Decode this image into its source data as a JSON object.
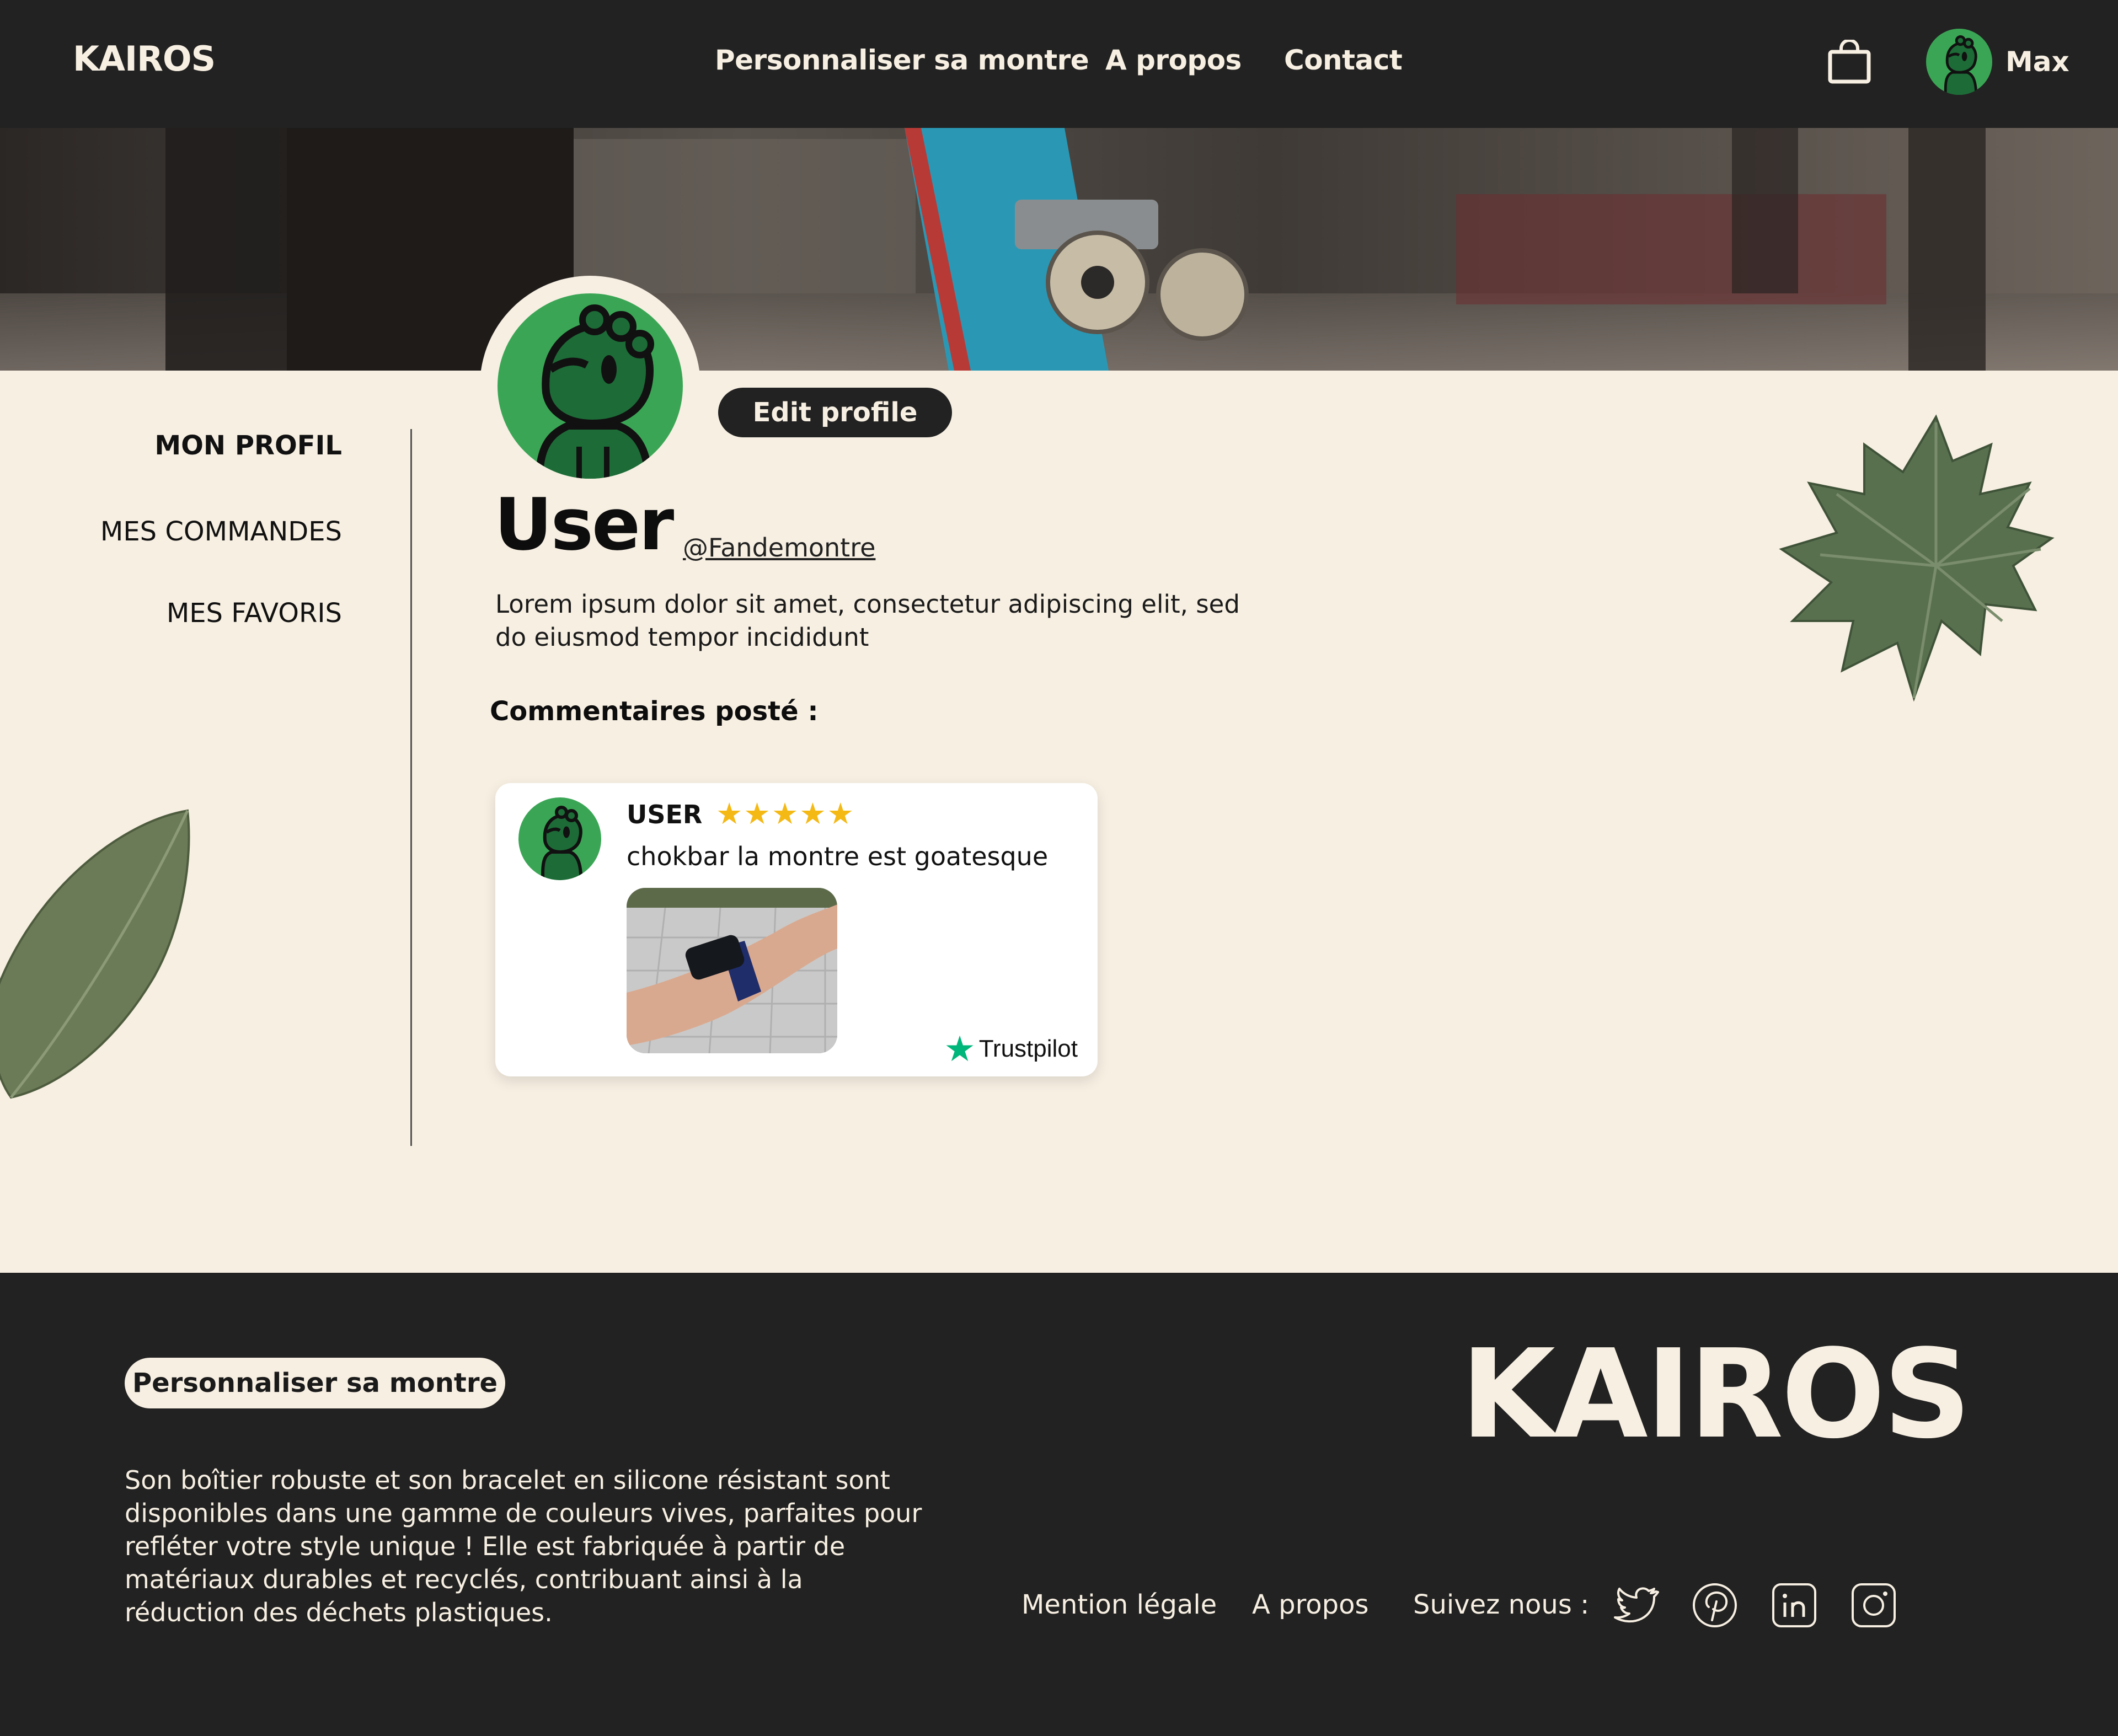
{
  "header": {
    "logo": "KAIROS",
    "nav": [
      "Personnaliser sa montre",
      "A propos",
      "Contact"
    ],
    "user_name": "Max"
  },
  "profile": {
    "edit_label": "Edit profile",
    "name": "User",
    "handle": "@Fandemontre",
    "bio": "Lorem ipsum dolor sit amet, consectetur adipiscing elit, sed do eiusmod tempor incididunt",
    "comments_title": "Commentaires posté :"
  },
  "side_menu": {
    "items": [
      "MON PROFIL",
      "MES COMMANDES",
      "MES FAVORIS"
    ],
    "active": "MON PROFIL"
  },
  "comment": {
    "user": "USER",
    "rating": 5,
    "stars": "★★★★★",
    "text": "chokbar la montre est goatesque",
    "source": "Trustpilot"
  },
  "footer": {
    "cta": "Personnaliser sa montre",
    "description": "Son boîtier robuste et son bracelet en silicone résistant sont disponibles dans une gamme de couleurs vives, parfaites pour refléter votre style unique ! Elle est fabriquée à partir de matériaux durables et recyclés, contribuant ainsi à la réduction des déchets plastiques.",
    "logo": "KAIROS",
    "links": [
      "Mention légale",
      "A propos"
    ],
    "follow_label": "Suivez nous :",
    "socials": [
      "twitter-icon",
      "pinterest-icon",
      "linkedin-icon",
      "instagram-icon"
    ]
  },
  "colors": {
    "dark": "#222222",
    "cream": "#f7efe2",
    "avatar_green": "#3aa655",
    "star_yellow": "#f5b915",
    "trustpilot_green": "#00b67a"
  }
}
